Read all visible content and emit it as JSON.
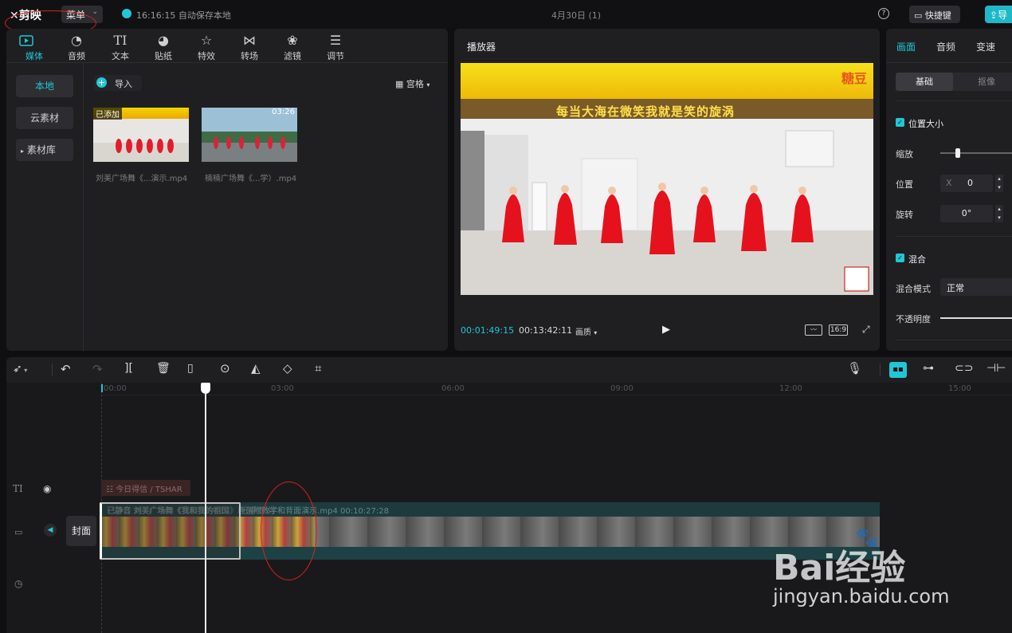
{
  "app": {
    "logo": "剪映",
    "menu": "菜单",
    "autosave": "16:16:15 自动保存本地",
    "project_title": "4月30日 (1)",
    "shortcut": "快捷键",
    "export": "导"
  },
  "media_tabs": [
    {
      "label": "媒体",
      "icon": "media-icon"
    },
    {
      "label": "音频",
      "icon": "audio-icon"
    },
    {
      "label": "文本",
      "icon": "text-icon"
    },
    {
      "label": "贴纸",
      "icon": "sticker-icon"
    },
    {
      "label": "特效",
      "icon": "effects-icon"
    },
    {
      "label": "转场",
      "icon": "transition-icon"
    },
    {
      "label": "滤镜",
      "icon": "filter-icon"
    },
    {
      "label": "调节",
      "icon": "adjust-icon"
    }
  ],
  "media_sidebar": [
    "本地",
    "云素材",
    "素材库"
  ],
  "media": {
    "import": "导入",
    "view": "宫格",
    "items": [
      {
        "badge": "已添加",
        "duration": "",
        "name": "刘美广场舞《...演示.mp4"
      },
      {
        "badge": "",
        "duration": "03:26",
        "name": "楠楠广场舞《...学）.mp4"
      }
    ]
  },
  "player": {
    "title": "播放器",
    "current": "00:01:49:15",
    "total": "00:13:42:11",
    "quality": "画质",
    "ratio": "16:9",
    "video_caption": "每当大海在微笑我就是笑的旋涡",
    "logo_text": "糖豆"
  },
  "props": {
    "tabs": [
      "画面",
      "音频",
      "变速"
    ],
    "subtabs": [
      "基础",
      "抠像"
    ],
    "section1": "位置大小",
    "scale": "缩放",
    "position": "位置",
    "pos_x_label": "X",
    "pos_x": "0",
    "rotate": "旋转",
    "rotate_val": "0°",
    "section2": "混合",
    "blend_mode_label": "混合模式",
    "blend_mode": "正常",
    "opacity": "不透明度"
  },
  "timeline": {
    "ruler": [
      "00:00",
      "03:00",
      "06:00",
      "09:00",
      "12:00",
      "15:00"
    ],
    "text_clip": "今日得信 / TSHAR",
    "clip1_label": "已静音  刘美广场舞《我和我的祖国",
    "clip2_label": "已静音  刘",
    "clip3_label": "已静音  刘美广场舞《我和我的祖国》原创附教学和背面演示.mp4  00:10:27:28",
    "cover": "封面"
  },
  "watermark": {
    "brand": "Bai经验",
    "url": "jingyan.baidu.com"
  },
  "colors": {
    "accent": "#21c7d6",
    "annotation": "#e02020"
  }
}
